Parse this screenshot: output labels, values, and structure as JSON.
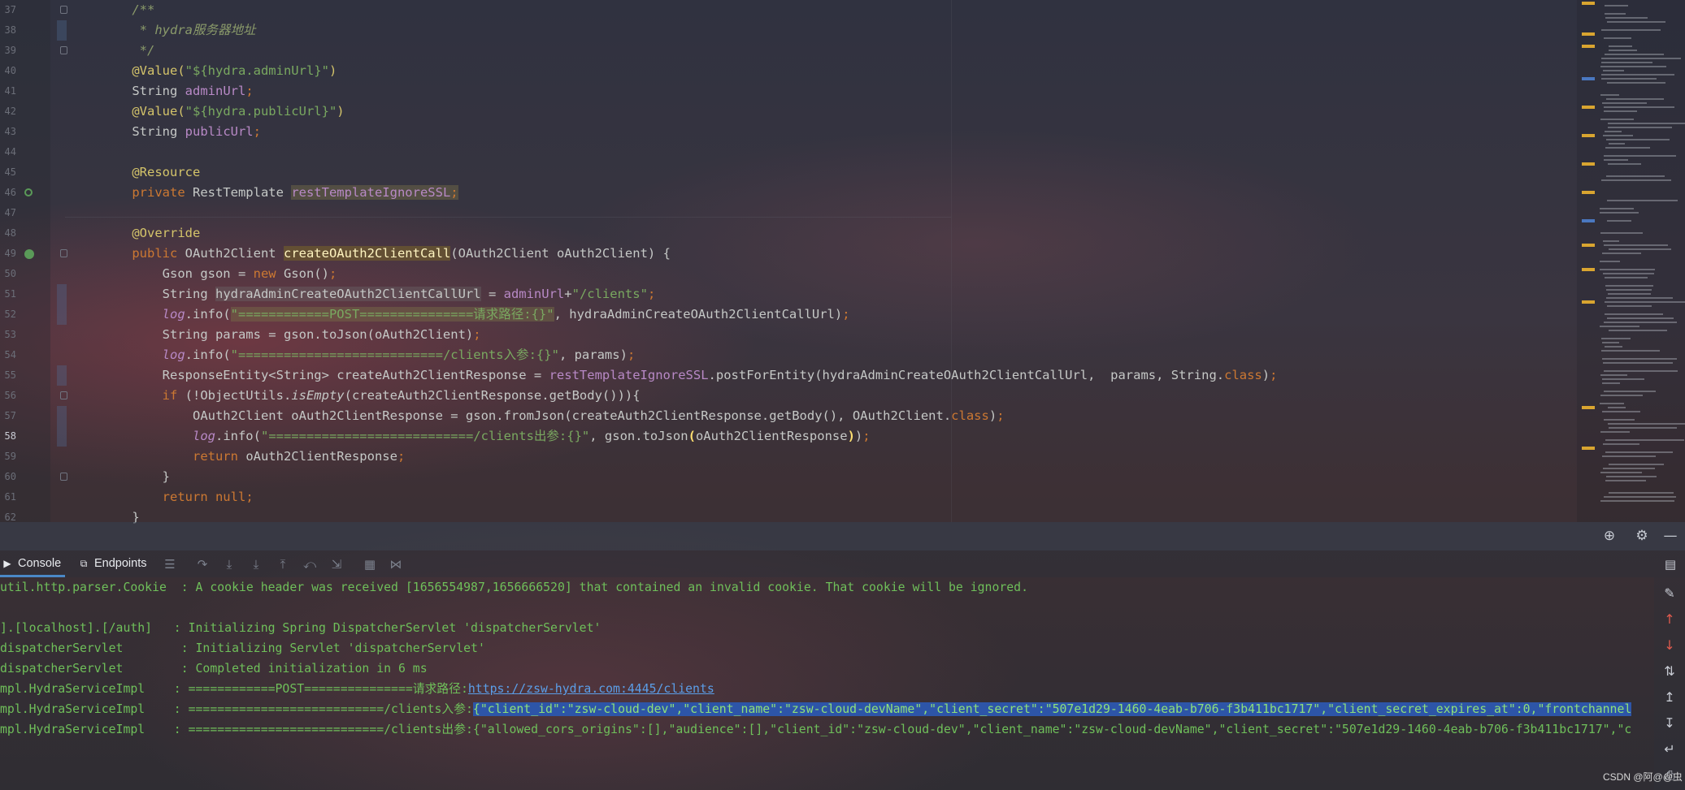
{
  "editor": {
    "lines": [
      {
        "num": "37",
        "segments": [
          {
            "t": "    /**",
            "c": "c-com"
          }
        ]
      },
      {
        "num": "38",
        "segments": [
          {
            "t": "     * hydra服务器地址",
            "c": "c-com"
          }
        ]
      },
      {
        "num": "39",
        "segments": [
          {
            "t": "     */",
            "c": "c-com"
          }
        ]
      },
      {
        "num": "40",
        "segments": [
          {
            "t": "    @Value(",
            "c": "c-ann"
          },
          {
            "t": "\"${hydra.adminUrl}\"",
            "c": "c-str"
          },
          {
            "t": ")",
            "c": "c-ann"
          }
        ]
      },
      {
        "num": "41",
        "segments": [
          {
            "t": "    String ",
            "c": "c-plain"
          },
          {
            "t": "adminUrl",
            "c": "c-fld"
          },
          {
            "t": ";",
            "c": "c-kw"
          }
        ]
      },
      {
        "num": "42",
        "segments": [
          {
            "t": "    @Value(",
            "c": "c-ann"
          },
          {
            "t": "\"${hydra.publicUrl}\"",
            "c": "c-str"
          },
          {
            "t": ")",
            "c": "c-ann"
          }
        ]
      },
      {
        "num": "43",
        "segments": [
          {
            "t": "    String ",
            "c": "c-plain"
          },
          {
            "t": "publicUrl",
            "c": "c-fld"
          },
          {
            "t": ";",
            "c": "c-kw"
          }
        ]
      },
      {
        "num": "44",
        "segments": []
      },
      {
        "num": "45",
        "segments": [
          {
            "t": "    @Resource",
            "c": "c-ann"
          }
        ]
      },
      {
        "num": "46",
        "segments": [
          {
            "t": "    private ",
            "c": "c-kw"
          },
          {
            "t": "RestTemplate ",
            "c": "c-plain"
          },
          {
            "t": "restTemplateIgnoreSSL",
            "c": "c-fld hl-warn"
          },
          {
            "t": ";",
            "c": "c-kw hl-warn"
          }
        ]
      },
      {
        "num": "47",
        "segments": []
      },
      {
        "num": "48",
        "segments": [
          {
            "t": "    @Override",
            "c": "c-ann"
          }
        ]
      },
      {
        "num": "49",
        "segments": [
          {
            "t": "    public ",
            "c": "c-kw"
          },
          {
            "t": "OAuth2Client ",
            "c": "c-plain"
          },
          {
            "t": "createOAuth2ClientCall",
            "c": "hl-def"
          },
          {
            "t": "(OAuth2Client oAuth2Client) {",
            "c": "c-plain"
          }
        ]
      },
      {
        "num": "50",
        "segments": [
          {
            "t": "        Gson gson = ",
            "c": "c-plain"
          },
          {
            "t": "new ",
            "c": "c-kw"
          },
          {
            "t": "Gson()",
            "c": "c-plain"
          },
          {
            "t": ";",
            "c": "c-kw"
          }
        ]
      },
      {
        "num": "51",
        "segments": [
          {
            "t": "        String ",
            "c": "c-plain"
          },
          {
            "t": "hydraAdminCreateOAuth2ClientCallUrl",
            "c": "c-plain hl-box"
          },
          {
            "t": " = ",
            "c": "c-plain"
          },
          {
            "t": "adminUrl",
            "c": "c-fld"
          },
          {
            "t": "+",
            "c": "c-plain"
          },
          {
            "t": "\"/clients\"",
            "c": "c-str"
          },
          {
            "t": ";",
            "c": "c-kw"
          }
        ]
      },
      {
        "num": "52",
        "segments": [
          {
            "t": "        ",
            "c": "c-plain"
          },
          {
            "t": "log",
            "c": "c-logf"
          },
          {
            "t": ".info(",
            "c": "c-plain"
          },
          {
            "t": "\"============POST===============请求路径:{}\"",
            "c": "c-str hl-warn"
          },
          {
            "t": ", hydraAdminCreateOAuth2ClientCallUrl)",
            "c": "c-plain"
          },
          {
            "t": ";",
            "c": "c-kw"
          }
        ]
      },
      {
        "num": "53",
        "segments": [
          {
            "t": "        String params = gson.toJson(oAuth2Client)",
            "c": "c-plain"
          },
          {
            "t": ";",
            "c": "c-kw"
          }
        ]
      },
      {
        "num": "54",
        "segments": [
          {
            "t": "        ",
            "c": "c-plain"
          },
          {
            "t": "log",
            "c": "c-logf"
          },
          {
            "t": ".info(",
            "c": "c-plain"
          },
          {
            "t": "\"===========================/clients入参:{}\"",
            "c": "c-str"
          },
          {
            "t": ", params)",
            "c": "c-plain"
          },
          {
            "t": ";",
            "c": "c-kw"
          }
        ]
      },
      {
        "num": "55",
        "segments": [
          {
            "t": "        ResponseEntity<String> createAuth2ClientResponse = ",
            "c": "c-plain"
          },
          {
            "t": "restTemplateIgnoreSSL",
            "c": "c-fld"
          },
          {
            "t": ".postForEntity(hydraAdminCreateOAuth2ClientCallUrl,  params, String.",
            "c": "c-plain"
          },
          {
            "t": "class",
            "c": "c-kw"
          },
          {
            "t": ")",
            "c": "c-plain"
          },
          {
            "t": ";",
            "c": "c-kw"
          }
        ]
      },
      {
        "num": "56",
        "segments": [
          {
            "t": "        ",
            "c": "c-plain"
          },
          {
            "t": "if ",
            "c": "c-kw"
          },
          {
            "t": "(!ObjectUtils.",
            "c": "c-plain"
          },
          {
            "t": "isEmpty",
            "c": "c-plain c-ital"
          },
          {
            "t": "(createAuth2ClientResponse.getBody())){",
            "c": "c-plain"
          }
        ]
      },
      {
        "num": "57",
        "segments": [
          {
            "t": "            OAuth2Client oAuth2ClientResponse = gson.fromJson(createAuth2ClientResponse.getBody(), OAuth2Client.",
            "c": "c-plain"
          },
          {
            "t": "class",
            "c": "c-kw"
          },
          {
            "t": ")",
            "c": "c-plain"
          },
          {
            "t": ";",
            "c": "c-kw"
          }
        ]
      },
      {
        "num": "58",
        "current": true,
        "segments": [
          {
            "t": "            ",
            "c": "c-plain"
          },
          {
            "t": "log",
            "c": "c-logf"
          },
          {
            "t": ".info(",
            "c": "c-plain"
          },
          {
            "t": "\"===========================/clients出参:{}\"",
            "c": "c-str"
          },
          {
            "t": ", gson.toJson",
            "c": "c-plain"
          },
          {
            "t": "(",
            "c": "br-hl"
          },
          {
            "t": "oAuth2ClientResponse",
            "c": "c-plain"
          },
          {
            "t": ")",
            "c": "br-hl"
          },
          {
            "t": ")",
            "c": "c-plain"
          },
          {
            "t": ";",
            "c": "c-kw"
          }
        ]
      },
      {
        "num": "59",
        "segments": [
          {
            "t": "            ",
            "c": "c-plain"
          },
          {
            "t": "return ",
            "c": "c-kw"
          },
          {
            "t": "oAuth2ClientResponse",
            "c": "c-plain"
          },
          {
            "t": ";",
            "c": "c-kw"
          }
        ]
      },
      {
        "num": "60",
        "segments": [
          {
            "t": "        }",
            "c": "c-plain"
          }
        ]
      },
      {
        "num": "61",
        "segments": [
          {
            "t": "        ",
            "c": "c-plain"
          },
          {
            "t": "return null",
            "c": "c-kw"
          },
          {
            "t": ";",
            "c": "c-kw"
          }
        ]
      },
      {
        "num": "62",
        "segments": [
          {
            "t": "    }",
            "c": "c-plain"
          }
        ]
      }
    ]
  },
  "toolbar": {
    "icons": [
      "crosshair-icon",
      "gear-icon",
      "minimize-icon"
    ]
  },
  "console_panel": {
    "tabs": [
      {
        "label": "Console",
        "icon": "console-icon",
        "active": true
      },
      {
        "label": "Endpoints",
        "icon": "endpoints-icon",
        "active": false
      }
    ],
    "header_icons": [
      "list-icon",
      "step-over-icon",
      "step-into-icon",
      "force-step-into-icon",
      "step-out-icon",
      "drop-frame-icon",
      "run-to-cursor-icon",
      "evaluate-icon",
      "trace-icon"
    ],
    "log_lines": [
      {
        "segments": [
          {
            "t": "util.http.parser.Cookie  : A cookie header was received [1656554987,1656666520] that contained an invalid cookie. That cookie will be ignored.",
            "k": ""
          }
        ]
      },
      {
        "segments": [
          {
            "t": "",
            "k": ""
          }
        ]
      },
      {
        "segments": [
          {
            "t": "].[localhost].[/auth]   : Initializing Spring DispatcherServlet 'dispatcherServlet'",
            "k": ""
          }
        ]
      },
      {
        "segments": [
          {
            "t": "dispatcherServlet        : Initializing Servlet 'dispatcherServlet'",
            "k": ""
          }
        ]
      },
      {
        "segments": [
          {
            "t": "dispatcherServlet        : Completed initialization in 6 ms",
            "k": ""
          }
        ]
      },
      {
        "segments": [
          {
            "t": "mpl.HydraServiceImpl    : ============POST===============请求路径:",
            "k": ""
          },
          {
            "t": "https://zsw-hydra.com:4445/clients",
            "k": "link"
          }
        ]
      },
      {
        "segments": [
          {
            "t": "mpl.HydraServiceImpl    : ===========================/clients入参:",
            "k": ""
          },
          {
            "t": "{\"client_id\":\"zsw-cloud-dev\",\"client_name\":\"zsw-cloud-devName\",\"client_secret\":\"507e1d29-1460-4eab-b706-f3b411bc1717\",\"client_secret_expires_at\":0,\"frontchannel",
            "k": "sel"
          }
        ]
      },
      {
        "segments": [
          {
            "t": "mpl.HydraServiceImpl    : ===========================/clients出参:{\"allowed_cors_origins\":[],\"audience\":[],\"client_id\":\"zsw-cloud-dev\",\"client_name\":\"zsw-cloud-devName\",\"client_secret\":\"507e1d29-1460-4eab-b706-f3b411bc1717\",\"c",
            "k": ""
          }
        ]
      }
    ],
    "side_icons": [
      "clear-icon",
      "arrow-up-icon",
      "arrow-down-icon",
      "sort-icon",
      "scroll-up-icon",
      "scroll-down-icon",
      "soft-wrap-icon",
      "print-icon"
    ]
  },
  "watermark": "CSDN @阿@@虫"
}
